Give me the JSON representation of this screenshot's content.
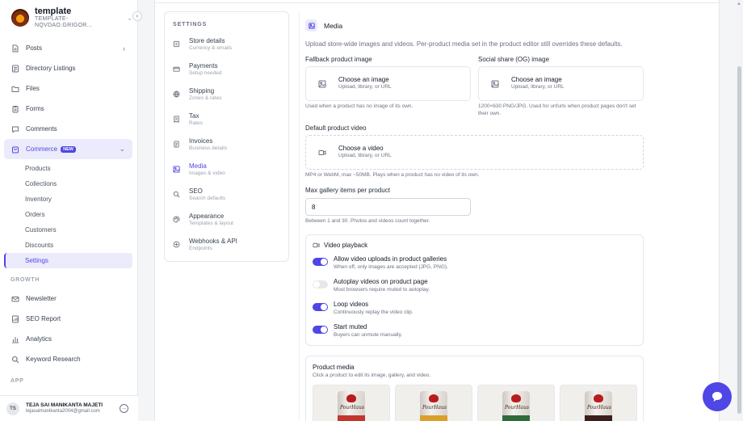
{
  "brand": {
    "name": "template",
    "subtitle": "TEMPLATE-NQVDAO.GRIGOR..."
  },
  "nav": {
    "items": [
      {
        "label": "Posts",
        "icon": "file-icon"
      },
      {
        "label": "Directory Listings",
        "icon": "list-icon"
      },
      {
        "label": "Files",
        "icon": "folder-icon"
      },
      {
        "label": "Forms",
        "icon": "clipboard-icon"
      },
      {
        "label": "Comments",
        "icon": "chat-bubble-icon"
      },
      {
        "label": "Commerce",
        "icon": "bag-icon",
        "badge": "NEW"
      }
    ],
    "commerce_sub": [
      "Products",
      "Collections",
      "Inventory",
      "Orders",
      "Customers",
      "Discounts",
      "Settings"
    ],
    "growth_label": "GROWTH",
    "growth_items": [
      {
        "label": "Newsletter",
        "icon": "mail-icon"
      },
      {
        "label": "SEO Report",
        "icon": "report-icon"
      },
      {
        "label": "Analytics",
        "icon": "chart-icon"
      },
      {
        "label": "Keyword Research",
        "icon": "search-icon"
      }
    ],
    "app_label": "APP"
  },
  "user": {
    "initials": "TS",
    "name": "TEJA SAI MANIKANTA MAJETI",
    "email": "tejasaimanikanta2004@gmail.com"
  },
  "settings_nav": {
    "title": "SETTINGS",
    "items": [
      {
        "title": "Store details",
        "sub": "Currency & emails",
        "icon": "store-icon"
      },
      {
        "title": "Payments",
        "sub": "Setup needed",
        "icon": "card-icon"
      },
      {
        "title": "Shipping",
        "sub": "Zones & rates",
        "icon": "globe-icon"
      },
      {
        "title": "Tax",
        "sub": "Rates",
        "icon": "receipt-icon"
      },
      {
        "title": "Invoices",
        "sub": "Business details",
        "icon": "invoice-icon"
      },
      {
        "title": "Media",
        "sub": "Images & video",
        "icon": "image-icon"
      },
      {
        "title": "SEO",
        "sub": "Search defaults",
        "icon": "search-icon"
      },
      {
        "title": "Appearance",
        "sub": "Templates & layout",
        "icon": "palette-icon"
      },
      {
        "title": "Webhooks & API",
        "sub": "Endpoints",
        "icon": "webhook-icon"
      }
    ]
  },
  "media": {
    "title": "Media",
    "description": "Upload store-wide images and videos. Per-product media set in the product editor still overrides these defaults.",
    "fallback": {
      "label": "Fallback product image",
      "title": "Choose an image",
      "sub": "Upload, library, or URL",
      "help": "Used when a product has no image of its own."
    },
    "og": {
      "label": "Social share (OG) image",
      "title": "Choose an image",
      "sub": "Upload, library, or URL",
      "help": "1200×630 PNG/JPG. Used for unfurls when product pages don't set their own."
    },
    "video": {
      "label": "Default product video",
      "title": "Choose a video",
      "sub": "Upload, library, or URL",
      "help": "MP4 or WebM, max ~50MB. Plays when a product has no video of its own."
    },
    "gallery": {
      "label": "Max gallery items per product",
      "value": "8",
      "help": "Between 1 and 30. Photos and videos count together."
    },
    "playback": {
      "title": "Video playback",
      "toggles": [
        {
          "title": "Allow video uploads in product galleries",
          "sub": "When off, only images are accepted (JPG, PNG).",
          "on": true
        },
        {
          "title": "Autoplay videos on product page",
          "sub": "Most browsers require muted to autoplay.",
          "on": false
        },
        {
          "title": "Loop videos",
          "sub": "Continuously replay the video clip.",
          "on": true
        },
        {
          "title": "Start muted",
          "sub": "Buyers can unmute manually.",
          "on": true
        }
      ]
    },
    "product_media": {
      "title": "Product media",
      "sub": "Click a product to edit its image, gallery, and video.",
      "products": [
        {
          "label": "PourHaus",
          "band": "#c2362d"
        },
        {
          "label": "PourHaus",
          "band": "#d9a02a"
        },
        {
          "label": "PourHaus",
          "band": "#2f6b3a"
        },
        {
          "label": "PourHaus",
          "band": "#3a1f1a"
        }
      ]
    }
  },
  "colors": {
    "accent": "#4f46e5",
    "accent_soft": "#ecebfb"
  }
}
